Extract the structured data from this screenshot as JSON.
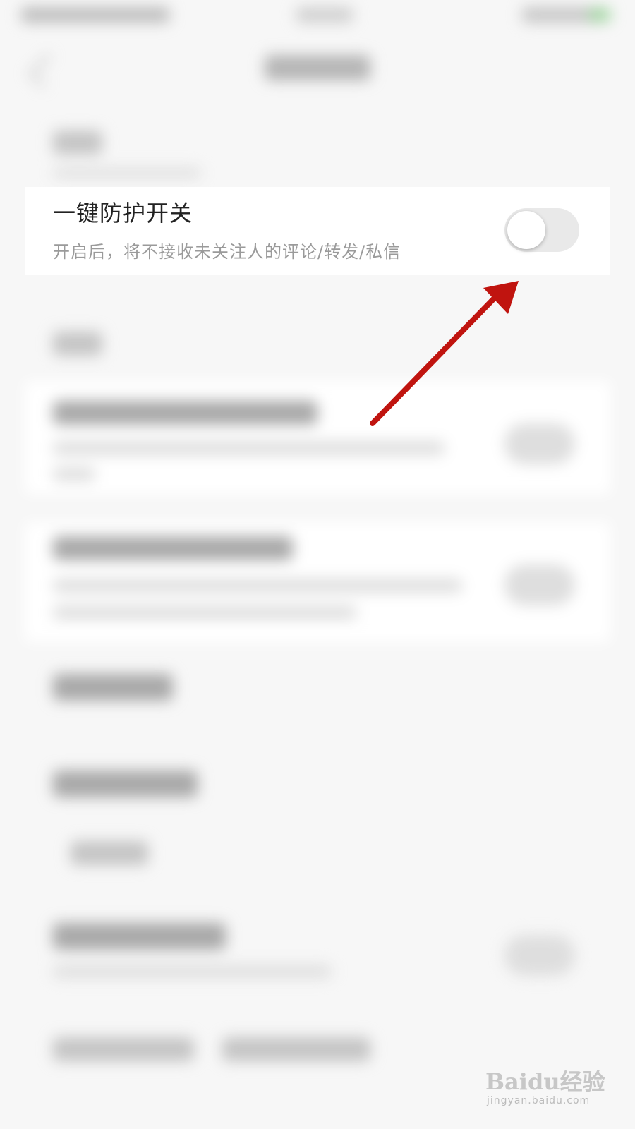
{
  "card": {
    "title": "一键防护开关",
    "description": "开启后，将不接收未关注人的评论/转发/私信",
    "toggle_state": "off"
  },
  "colors": {
    "annotation_arrow": "#c0140f",
    "toggle_track": "#e9e9e9",
    "title_text": "#222222",
    "description_text": "#9a9a9a"
  },
  "watermark": {
    "brand": "Baidu经验",
    "url": "jingyan.baidu.com"
  }
}
